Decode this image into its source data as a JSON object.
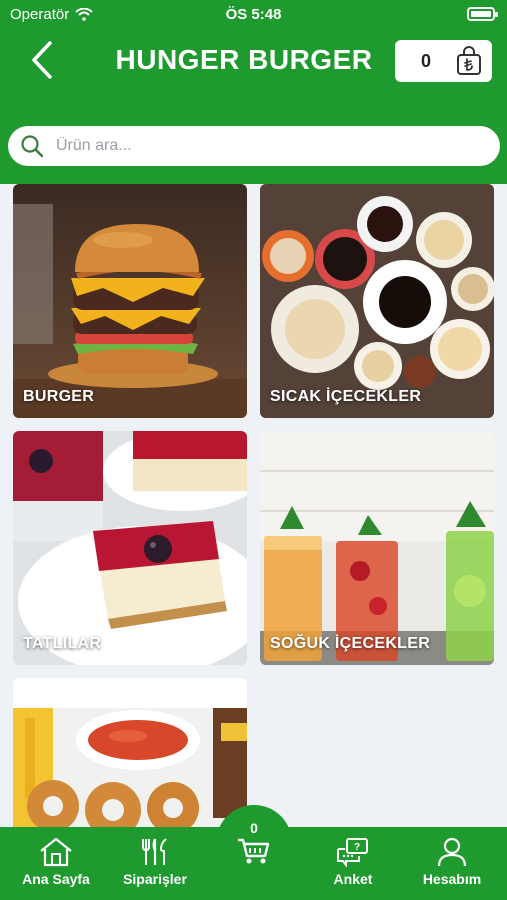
{
  "status_bar": {
    "carrier": "Operatör",
    "time": "ÖS 5:48"
  },
  "header": {
    "title": "HUNGER BURGER",
    "cart_count": "0",
    "back_icon": "chevron-left-icon",
    "cart_icon": "shopping-bag-lira-icon"
  },
  "search": {
    "placeholder": "Ürün ara...",
    "value": ""
  },
  "categories": [
    {
      "label": "BURGER"
    },
    {
      "label": "SICAK İÇECEKLER"
    },
    {
      "label": "TATLILAR"
    },
    {
      "label": "SOĞUK İÇECEKLER"
    },
    {
      "label": ""
    }
  ],
  "bottom_nav": {
    "items": [
      {
        "label": "Ana Sayfa",
        "icon": "home-icon"
      },
      {
        "label": "Siparişler",
        "icon": "cutlery-icon"
      },
      {
        "label": "Anket",
        "icon": "chat-question-icon"
      },
      {
        "label": "Hesabım",
        "icon": "user-icon"
      }
    ],
    "cart_count": "0"
  },
  "colors": {
    "brand_green": "#1e9a2f",
    "white": "#ffffff"
  }
}
